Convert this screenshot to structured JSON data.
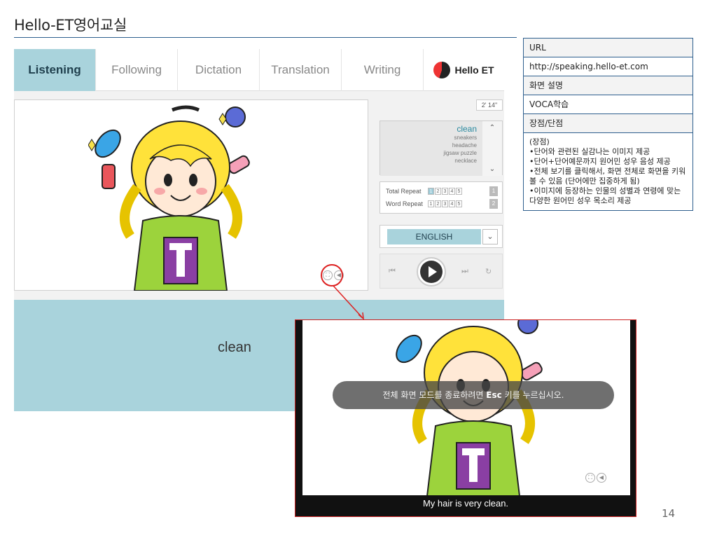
{
  "slide": {
    "title": "Hello-ET영어교실",
    "page_number": "14"
  },
  "tabs": [
    {
      "label": "Listening"
    },
    {
      "label": "Following"
    },
    {
      "label": "Dictation"
    },
    {
      "label": "Translation"
    },
    {
      "label": "Writing"
    }
  ],
  "brand": {
    "name": "Hello ET",
    "colors": {
      "accent": "#a9d3dc",
      "logo_red": "#e33333"
    }
  },
  "player": {
    "timer": "2' 14\"",
    "word_list": {
      "current": "clean",
      "others": [
        "sneakers",
        "headache",
        "jigsaw puzzle",
        "necklace"
      ]
    },
    "total_repeat_label": "Total Repeat",
    "word_repeat_label": "Word Repeat",
    "repeat_options": [
      "1",
      "2",
      "3",
      "4",
      "5"
    ],
    "total_repeat_count": "1",
    "word_repeat_count": "2",
    "language": "ENGLISH",
    "word": "clean",
    "icons": [
      "fullscreen-icon",
      "speaker-icon",
      "prev-icon",
      "play-icon",
      "next-icon",
      "repeat-icon"
    ]
  },
  "info": {
    "url_label": "URL",
    "url": "http://speaking.hello-et.com",
    "desc_label": "화면 설명",
    "desc": "VOCA학습",
    "pros_label": "장점/단점",
    "pros_heading": "(장점)",
    "pros": [
      "•단어와 관련된 실감나는 이미지 제공",
      "•단어+단어예문까지 원어민 성우 음성 제공",
      "•전체 보기를 클릭해서, 화면 전체로 화면을 키워 볼 수 있음 (단어에만 집중하게 됨)",
      "•이미지에 등장하는 인물의 성별과 연령에 맞는 다양한 원어민 성우 목소리 제공"
    ]
  },
  "fullscreen": {
    "notice_pre": "전체 화면 모드를 종료하려면",
    "notice_key": "Esc",
    "notice_post": "키를 누르십시오.",
    "caption": "My hair is very clean."
  }
}
